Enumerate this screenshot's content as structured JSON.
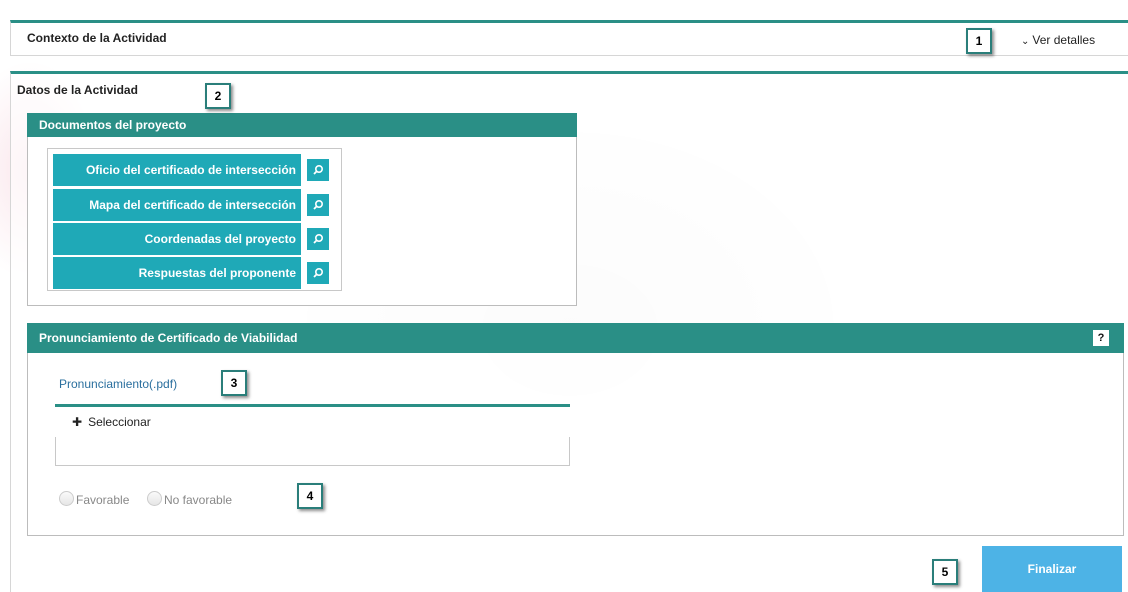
{
  "context_panel": {
    "title": "Contexto de la Actividad",
    "details_link": "Ver detalles"
  },
  "activity_panel": {
    "title": "Datos de la Actividad"
  },
  "documents": {
    "header": "Documentos del proyecto",
    "items": [
      {
        "label": "Oficio del certificado de intersección"
      },
      {
        "label": "Mapa del certificado de intersección"
      },
      {
        "label": "Coordenadas del proyecto"
      },
      {
        "label": "Respuestas del proponente"
      }
    ],
    "icon": "search-icon"
  },
  "pronouncement": {
    "header": "Pronunciamiento de Certificado de Viabilidad",
    "help_label": "?",
    "file_label": "Pronunciamiento(.pdf)",
    "select_label": "Seleccionar",
    "options": [
      {
        "label": "Favorable",
        "selected": false
      },
      {
        "label": "No favorable",
        "selected": false
      }
    ]
  },
  "actions": {
    "finish_label": "Finalizar"
  },
  "markers": [
    "1",
    "2",
    "3",
    "4",
    "5"
  ],
  "colors": {
    "header": "#2a8f86",
    "doc_button": "#1fa9b7",
    "finish_button": "#4db3e6"
  }
}
